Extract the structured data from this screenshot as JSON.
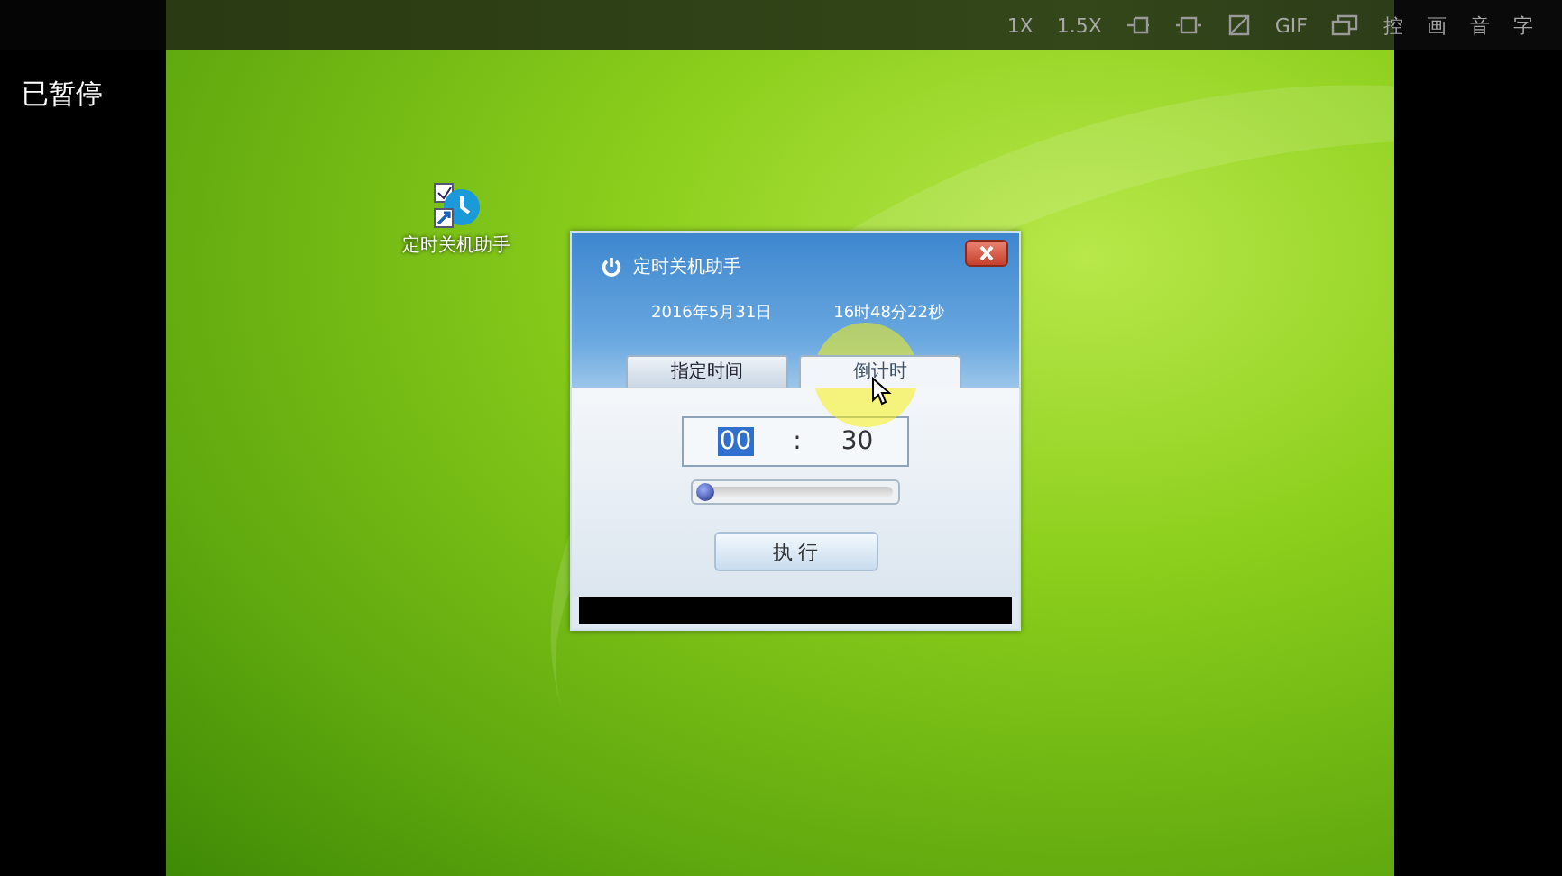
{
  "status": "已暂停",
  "toolbar": [
    {
      "kind": "text",
      "label": "1X"
    },
    {
      "kind": "text",
      "label": "1.5X"
    },
    {
      "kind": "icon"
    },
    {
      "kind": "icon"
    },
    {
      "kind": "icon"
    },
    {
      "kind": "text",
      "label": "GIF"
    },
    {
      "kind": "icon"
    },
    {
      "kind": "text",
      "label": "控"
    },
    {
      "kind": "text",
      "label": "画"
    },
    {
      "kind": "text",
      "label": "音"
    },
    {
      "kind": "text",
      "label": "字"
    }
  ],
  "desktop_icon": {
    "label": "定时关机助手"
  },
  "dialog": {
    "title": "定时关机助手",
    "date": "2016年5月31日",
    "time": "16时48分22秒",
    "tabs": [
      {
        "label": "指定时间",
        "selected": false
      },
      {
        "label": "倒计时",
        "selected": true
      }
    ],
    "time_field": {
      "hours": "00",
      "hours_selected": true,
      "separator": ":",
      "minutes": "30"
    },
    "slider": {
      "level": 0.04
    },
    "button": "执 行"
  }
}
